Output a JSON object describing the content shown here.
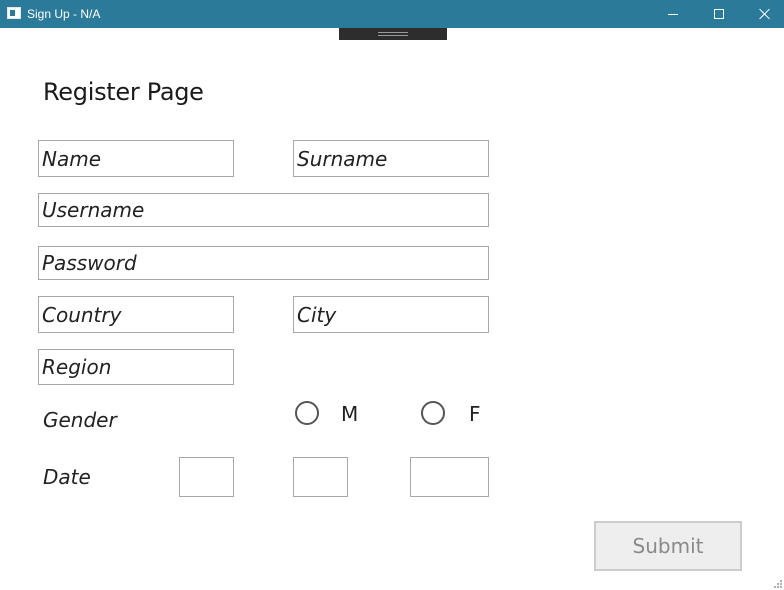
{
  "window": {
    "title": "Sign Up - N/A",
    "icons": {
      "app": "app-window-icon",
      "minimize": "minimize-icon",
      "maximize": "maximize-icon",
      "close": "close-icon"
    },
    "titlebar_color": "#2b7a99"
  },
  "page": {
    "title": "Register Page"
  },
  "form": {
    "name": {
      "placeholder": "Name",
      "value": ""
    },
    "surname": {
      "placeholder": "Surname",
      "value": ""
    },
    "username": {
      "placeholder": "Username",
      "value": ""
    },
    "password": {
      "placeholder": "Password",
      "value": ""
    },
    "country": {
      "placeholder": "Country",
      "value": ""
    },
    "city": {
      "placeholder": "City",
      "value": ""
    },
    "region": {
      "placeholder": "Region",
      "value": ""
    },
    "gender": {
      "label": "Gender",
      "options": [
        {
          "label": "M",
          "selected": false
        },
        {
          "label": "F",
          "selected": false
        }
      ]
    },
    "date": {
      "label": "Date",
      "day": "",
      "month": "",
      "year": ""
    },
    "submit_label": "Submit"
  }
}
